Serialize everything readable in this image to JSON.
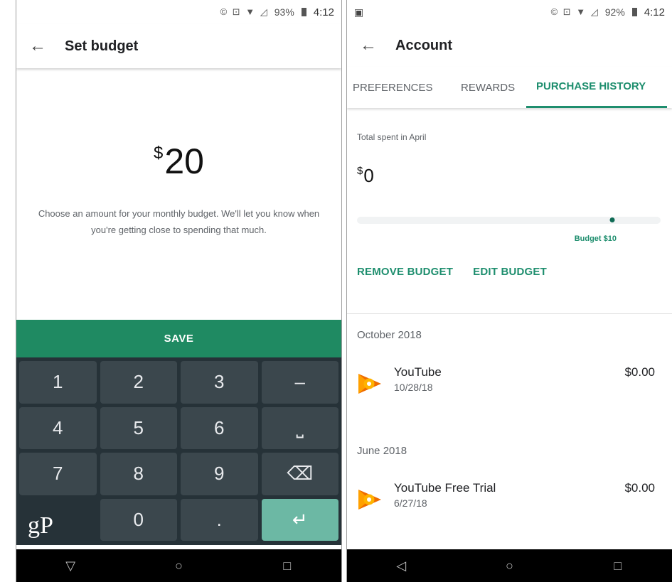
{
  "left": {
    "status_bar": {
      "icons": "© ⊡ ▼ ◿",
      "battery": "93%",
      "time": "4:12"
    },
    "app_bar": {
      "back_icon": "arrow-left-icon",
      "title": "Set budget"
    },
    "budget": {
      "currency": "$",
      "amount": "20",
      "description": "Choose an amount for your monthly budget. We'll let you know when you're getting close to spending that much."
    },
    "save_label": "SAVE",
    "keypad": {
      "k1": "1",
      "k2": "2",
      "k3": "3",
      "k_dash": "–",
      "k4": "4",
      "k5": "5",
      "k6": "6",
      "k_space": "⎵",
      "k7": "7",
      "k8": "8",
      "k9": "9",
      "k_back": "⌫",
      "k0": "0",
      "k_dot": ".",
      "k_enter": "↵"
    },
    "watermark": "gP",
    "nav": {
      "back": "▽",
      "home": "○",
      "recents": "□"
    }
  },
  "right": {
    "status_bar": {
      "left_icon": "image-icon",
      "icons": "© ⊡ ▼ ◿",
      "battery": "92%",
      "time": "4:12"
    },
    "app_bar": {
      "back_icon": "arrow-left-icon",
      "title": "Account"
    },
    "tabs": [
      {
        "label": "PREFERENCES",
        "selected": false
      },
      {
        "label": "REWARDS",
        "selected": false
      },
      {
        "label": "PURCHASE HISTORY",
        "selected": true
      }
    ],
    "summary": {
      "total_label": "Total spent in April",
      "currency": "$",
      "total_amount": "0",
      "budget_label": "Budget $10",
      "spent_fraction": 0.0,
      "budget_marker_fraction": 0.84
    },
    "actions": {
      "remove": "REMOVE BUDGET",
      "edit": "EDIT BUDGET"
    },
    "history": [
      {
        "month": "October 2018",
        "items": [
          {
            "name": "YouTube",
            "date": "10/28/18",
            "price": "$0.00",
            "icon": "google-play-music-icon"
          }
        ]
      },
      {
        "month": "June 2018",
        "items": [
          {
            "name": "YouTube Free Trial",
            "date": "6/27/18",
            "price": "$0.00",
            "icon": "google-play-music-icon"
          }
        ]
      }
    ],
    "nav": {
      "back": "◁",
      "home": "○",
      "recents": "□"
    }
  },
  "colors": {
    "accent": "#1e8e6e",
    "save_bar": "#1f8a62",
    "keyboard": "#263238",
    "key": "#3b474d",
    "enter_key": "#6cb8a4"
  }
}
